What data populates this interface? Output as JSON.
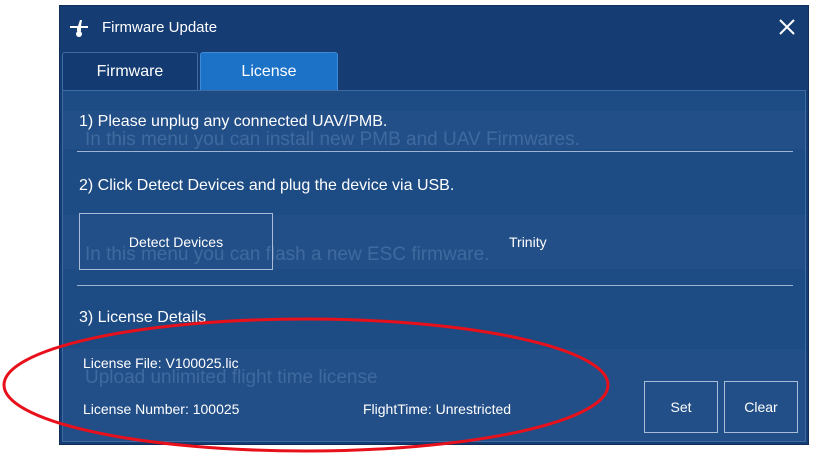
{
  "window": {
    "title": "Firmware Update",
    "app_icon": "drone-icon",
    "close_icon": "close-icon"
  },
  "tabs": [
    {
      "label": "Firmware",
      "active": false
    },
    {
      "label": "License",
      "active": true
    }
  ],
  "steps": {
    "step1": "1) Please unplug any connected UAV/PMB.",
    "step2": "2) Click Detect Devices and plug the device via USB.",
    "step3": "3) License Details"
  },
  "detect": {
    "button_label": "Detect Devices",
    "device_name": "Trinity"
  },
  "license": {
    "file": "License File: V100025.lic",
    "number": "License Number: 100025",
    "flight_time": "FlightTime: Unrestricted"
  },
  "buttons": {
    "set": "Set",
    "clear": "Clear"
  },
  "ghost_text": {
    "line1": "In this menu you can install new PMB and UAV Firmwares.",
    "line2": "In this menu you can flash a new ESC firmware.",
    "line3": "Upload unlimited flight time license"
  },
  "colors": {
    "window_bg": "#153c73",
    "active_tab": "#1b72c6",
    "content_bg": "#1d4b84",
    "annotation": "#e8101a"
  }
}
